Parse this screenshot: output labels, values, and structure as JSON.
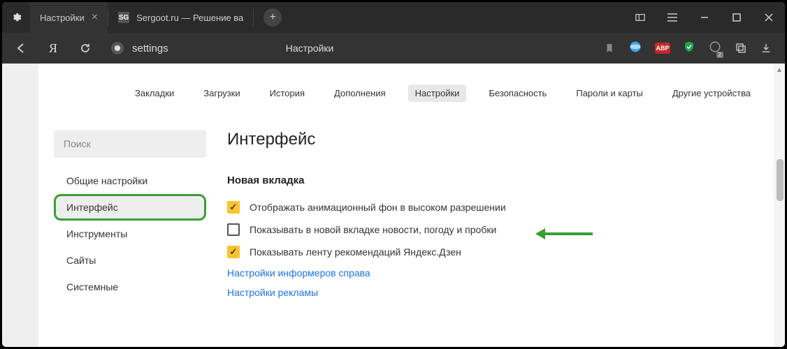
{
  "titlebar": {
    "tabs": [
      {
        "label": "Настройки"
      },
      {
        "label": "Sergoot.ru — Решение ва",
        "favicon": "SG"
      }
    ]
  },
  "toolbar": {
    "url_text": "settings",
    "page_title": "Настройки",
    "ext_abp": "ABP",
    "ext_badge_count": "2"
  },
  "nav": {
    "items": [
      "Закладки",
      "Загрузки",
      "История",
      "Дополнения",
      "Настройки",
      "Безопасность",
      "Пароли и карты",
      "Другие устройства"
    ],
    "active_index": 4
  },
  "sidebar": {
    "search_placeholder": "Поиск",
    "items": [
      "Общие настройки",
      "Интерфейс",
      "Инструменты",
      "Сайты",
      "Системные"
    ],
    "active_index": 1
  },
  "main": {
    "title": "Интерфейс",
    "subsection": "Новая вкладка",
    "checks": [
      {
        "checked": true,
        "label": "Отображать анимационный фон в высоком разрешении"
      },
      {
        "checked": false,
        "label": "Показывать в новой вкладке новости, погоду и пробки"
      },
      {
        "checked": true,
        "label": "Показывать ленту рекомендаций Яндекс.Дзен"
      }
    ],
    "links": [
      "Настройки информеров справа",
      "Настройки рекламы"
    ]
  }
}
